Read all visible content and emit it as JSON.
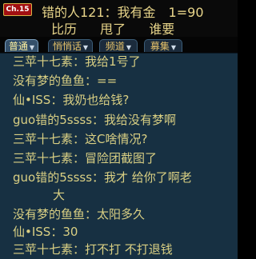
{
  "top": {
    "badge": "Ch.15",
    "line1_name": "错的人121：我有金",
    "line1_number": "1=90",
    "line2": [
      "比历",
      "甩了",
      "谁要"
    ]
  },
  "tabs": [
    {
      "label": "普通",
      "active": true
    },
    {
      "label": "悄悄话",
      "active": false
    },
    {
      "label": "频道",
      "active": false
    },
    {
      "label": "募集",
      "active": false
    }
  ],
  "chat": [
    {
      "speaker": "三苹十七素",
      "text": "我给1号了"
    },
    {
      "speaker": "没有梦的鱼鱼",
      "text": "=="
    },
    {
      "speaker": "仙•ISS",
      "text": "我奶也给钱?"
    },
    {
      "speaker": "guo错的5ssss",
      "text": "我给没有梦啊"
    },
    {
      "speaker": "三苹十七素",
      "text": "这C啥情况?"
    },
    {
      "speaker": "三苹十七素",
      "text": "冒险团截图了"
    },
    {
      "speaker": "guo错的5ssss",
      "text": "我才 给你了啊老"
    },
    {
      "speaker": "",
      "text": "大"
    },
    {
      "speaker": "没有梦的鱼鱼",
      "text": "太阳多久"
    },
    {
      "speaker": "仙•ISS",
      "text": "30"
    },
    {
      "speaker": "三苹十七素",
      "text": "打不打 不打退钱"
    }
  ]
}
